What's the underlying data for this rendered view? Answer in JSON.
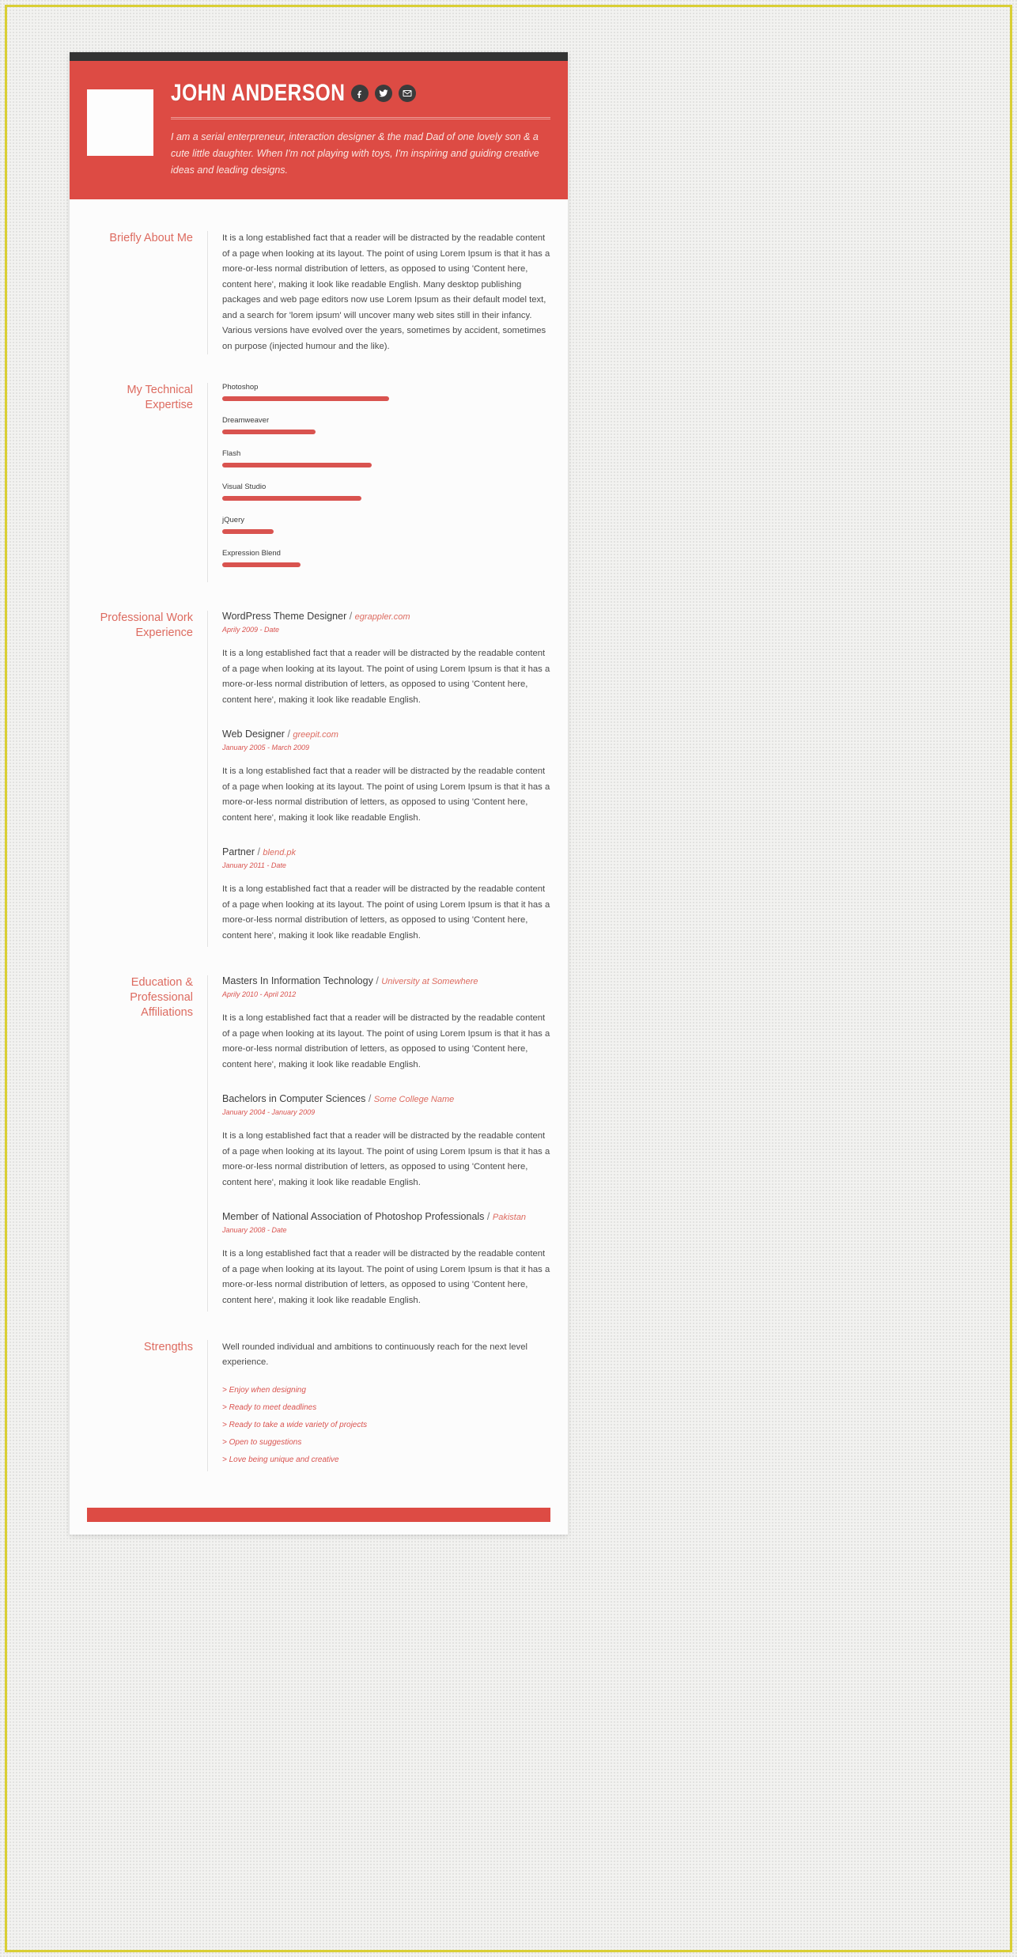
{
  "header": {
    "name": "JOHN ANDERSON",
    "photo_alt": "profile-photo-placeholder",
    "social": [
      {
        "name": "facebook-icon",
        "label": "Facebook"
      },
      {
        "name": "twitter-icon",
        "label": "Twitter"
      },
      {
        "name": "email-icon",
        "label": "Email"
      }
    ],
    "tagline": "I am a serial enterpreneur, interaction designer & the mad Dad of one lovely son & a cute little daughter. When I'm not playing with toys, I'm inspiring and guiding creative ideas and leading designs.",
    "accent_color": "#dd4b44",
    "topbar_color": "#333333"
  },
  "about": {
    "label": "Briefly About Me",
    "text": "It is a long established fact that a reader will be distracted by the readable content of a page when looking at its layout. The point of using Lorem Ipsum is that it has a more-or-less normal distribution of letters, as opposed to using 'Content here, content here', making it look like readable English. Many desktop publishing packages and web page editors now use Lorem Ipsum as their default model text, and a search for 'lorem ipsum' will uncover many web sites still in their infancy. Various versions have evolved over the years, sometimes by accident, sometimes on purpose (injected humour and the like)."
  },
  "skills": {
    "label": "My Technical Expertise",
    "items": [
      {
        "name": "Photoshop",
        "percent": 98
      },
      {
        "name": "Dreamweaver",
        "percent": 55
      },
      {
        "name": "Flash",
        "percent": 88
      },
      {
        "name": "Visual Studio",
        "percent": 82
      },
      {
        "name": "jQuery",
        "percent": 30
      },
      {
        "name": "Expression Blend",
        "percent": 46
      }
    ]
  },
  "experience": {
    "label": "Professional Work Experience",
    "entries": [
      {
        "title": "WordPress Theme Designer",
        "org": "egrappler.com",
        "date": "Aprily 2009 - Date",
        "desc": "It is a long established fact that a reader will be distracted by the readable content of a page when looking at its layout. The point of using Lorem Ipsum is that it has a more-or-less normal distribution of letters, as opposed to using 'Content here, content here', making it look like readable English."
      },
      {
        "title": "Web Designer",
        "org": "greepit.com",
        "date": "January 2005 - March 2009",
        "desc": "It is a long established fact that a reader will be distracted by the readable content of a page when looking at its layout. The point of using Lorem Ipsum is that it has a more-or-less normal distribution of letters, as opposed to using 'Content here, content here', making it look like readable English."
      },
      {
        "title": "Partner",
        "org": "blend.pk",
        "date": "January 2011 - Date",
        "desc": "It is a long established fact that a reader will be distracted by the readable content of a page when looking at its layout. The point of using Lorem Ipsum is that it has a more-or-less normal distribution of letters, as opposed to using 'Content here, content here', making it look like readable English."
      }
    ]
  },
  "education": {
    "label": "Education & Professional Affiliations",
    "entries": [
      {
        "title": "Masters In Information Technology",
        "org": "University at Somewhere",
        "date": "Aprily 2010 - April 2012",
        "desc": "It is a long established fact that a reader will be distracted by the readable content of a page when looking at its layout. The point of using Lorem Ipsum is that it has a more-or-less normal distribution of letters, as opposed to using 'Content here, content here', making it look like readable English."
      },
      {
        "title": "Bachelors in Computer Sciences",
        "org": "Some College Name",
        "date": "January 2004 - January 2009",
        "desc": "It is a long established fact that a reader will be distracted by the readable content of a page when looking at its layout. The point of using Lorem Ipsum is that it has a more-or-less normal distribution of letters, as opposed to using 'Content here, content here', making it look like readable English."
      },
      {
        "title": "Member of National Association of Photoshop Professionals",
        "org": "Pakistan",
        "date": "January 2008 - Date",
        "desc": "It is a long established fact that a reader will be distracted by the readable content of a page when looking at its layout. The point of using Lorem Ipsum is that it has a more-or-less normal distribution of letters, as opposed to using 'Content here, content here', making it look like readable English."
      }
    ]
  },
  "strengths": {
    "label": "Strengths",
    "intro": "Well rounded individual and ambitions to continuously reach for the next level experience.",
    "items": [
      "> Enjoy when designing",
      "> Ready to meet deadlines",
      "> Ready to take a wide variety of projects",
      "> Open to suggestions",
      "> Love being unique and creative"
    ]
  }
}
